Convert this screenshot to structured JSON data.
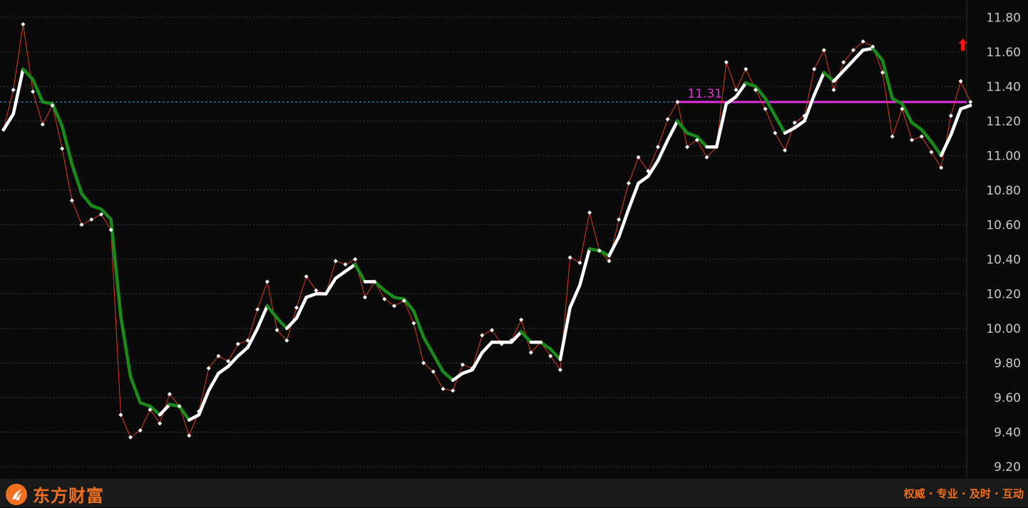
{
  "chart_data": {
    "type": "line",
    "y_ticks": [
      "11.80",
      "11.60",
      "11.40",
      "11.20",
      "11.00",
      "10.80",
      "10.60",
      "10.40",
      "10.20",
      "10.00",
      "9.80",
      "9.60",
      "9.40",
      "9.20"
    ],
    "ylim": [
      9.13,
      11.9
    ],
    "grid": true,
    "reference_line": {
      "value": 11.31,
      "label": "11.31"
    },
    "colors": {
      "price_line": "#e03a1e",
      "trend_up": "#ffffff",
      "trend_down": "#1a8a1a",
      "reference": "#e030e0",
      "dashed_ref": "#4aa8d8",
      "arrow": "#ff1010"
    },
    "series": [
      {
        "role": "price",
        "values": [
          11.15,
          11.38,
          11.76,
          11.37,
          11.18,
          11.29,
          11.04,
          10.74,
          10.6,
          10.63,
          10.66,
          10.57,
          9.5,
          9.37,
          9.41,
          9.53,
          9.45,
          9.62,
          9.55,
          9.38,
          9.52,
          9.77,
          9.84,
          9.81,
          9.91,
          9.93,
          10.11,
          10.27,
          9.99,
          9.93,
          10.12,
          10.3,
          10.22,
          10.2,
          10.39,
          10.37,
          10.4,
          10.18,
          10.27,
          10.17,
          10.13,
          10.16,
          10.03,
          9.8,
          9.75,
          9.65,
          9.64,
          9.79,
          9.77,
          9.96,
          9.99,
          9.91,
          9.93,
          10.05,
          9.86,
          9.92,
          9.84,
          9.76,
          10.41,
          10.38,
          10.67,
          10.45,
          10.39,
          10.63,
          10.84,
          10.99,
          10.91,
          11.05,
          11.21,
          11.31,
          11.05,
          11.09,
          10.99,
          11.05,
          11.54,
          11.38,
          11.5,
          11.38,
          11.27,
          11.13,
          11.03,
          11.19,
          11.23,
          11.5,
          11.61,
          11.38,
          11.54,
          11.61,
          11.66,
          11.63,
          11.48,
          11.11,
          11.27,
          11.09,
          11.11,
          11.02,
          10.93,
          11.23,
          11.43,
          11.31
        ]
      },
      {
        "role": "trend",
        "values": [
          11.15,
          11.24,
          11.5,
          11.44,
          11.31,
          11.3,
          11.17,
          10.95,
          10.78,
          10.71,
          10.69,
          10.63,
          10.07,
          9.72,
          9.57,
          9.55,
          9.5,
          9.56,
          9.55,
          9.47,
          9.5,
          9.64,
          9.74,
          9.78,
          9.84,
          9.89,
          10.0,
          10.13,
          10.06,
          10.0,
          10.06,
          10.18,
          10.2,
          10.2,
          10.29,
          10.33,
          10.37,
          10.27,
          10.27,
          10.22,
          10.18,
          10.17,
          10.1,
          9.95,
          9.85,
          9.75,
          9.7,
          9.74,
          9.76,
          9.86,
          9.92,
          9.92,
          9.92,
          9.98,
          9.92,
          9.92,
          9.88,
          9.82,
          10.12,
          10.25,
          10.46,
          10.45,
          10.42,
          10.53,
          10.69,
          10.84,
          10.88,
          10.97,
          11.09,
          11.2,
          11.13,
          11.11,
          11.05,
          11.05,
          11.3,
          11.34,
          11.42,
          11.4,
          11.33,
          11.23,
          11.13,
          11.16,
          11.2,
          11.35,
          11.48,
          11.43,
          11.49,
          11.55,
          11.61,
          11.62,
          11.55,
          11.33,
          11.3,
          11.19,
          11.15,
          11.08,
          11.0,
          11.12,
          11.27,
          11.29
        ]
      }
    ]
  },
  "footer": {
    "brand": "东方财富",
    "slogan": "权威 · 专业 · 及时 · 互动"
  }
}
